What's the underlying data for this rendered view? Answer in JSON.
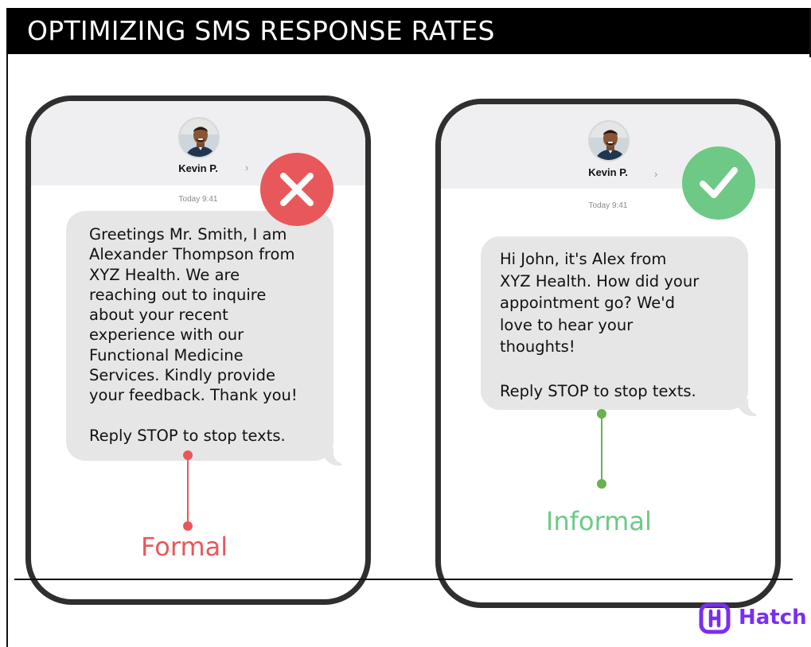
{
  "title": "OPTIMIZING SMS RESPONSE RATES",
  "left_phone": {
    "contact_name": "Kevin P.",
    "timestamp": "Today 9:41",
    "message": "Greetings Mr. Smith, I am\nAlexander Thompson from\nXYZ Health. We are\nreaching out to inquire\nabout your recent\nexperience with our\nFunctional Medicine\nServices. Kindly provide\nyour feedback. Thank you!\n\nReply STOP to stop texts.",
    "verdict_icon": "x-icon",
    "label": "Formal"
  },
  "right_phone": {
    "contact_name": "Kevin P.",
    "timestamp": "Today 9:41",
    "message": "Hi John, it's Alex from\nXYZ Health. How did your\nappointment go? We'd\nlove to hear your\nthoughts!\n\nReply STOP to stop texts.",
    "verdict_icon": "check-icon",
    "label": "Informal"
  },
  "brand": {
    "name": "Hatch",
    "icon": "hatch-logo-icon"
  },
  "colors": {
    "formal": "#e8585a",
    "informal": "#6dc985",
    "brand": "#7a2ef2",
    "bubble": "#e6e6e7"
  }
}
